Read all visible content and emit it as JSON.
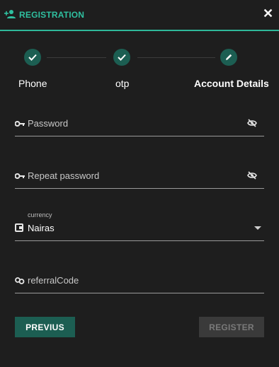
{
  "header": {
    "title": "REGISTRATION",
    "close_label": "✕"
  },
  "steps": [
    {
      "label": "Phone",
      "state": "done"
    },
    {
      "label": "otp",
      "state": "done"
    },
    {
      "label": "Account Details",
      "state": "active"
    }
  ],
  "form": {
    "password": {
      "placeholder": "Password"
    },
    "repeat_password": {
      "placeholder": "Repeat password"
    },
    "currency": {
      "label": "currency",
      "value": "Nairas"
    },
    "referral": {
      "placeholder": "referralCode"
    }
  },
  "buttons": {
    "previous": "PREVIUS",
    "register": "REGISTER"
  },
  "colors": {
    "accent": "#2fc0a0",
    "step_fill": "#1c5e52",
    "background": "#1e1e1e"
  }
}
